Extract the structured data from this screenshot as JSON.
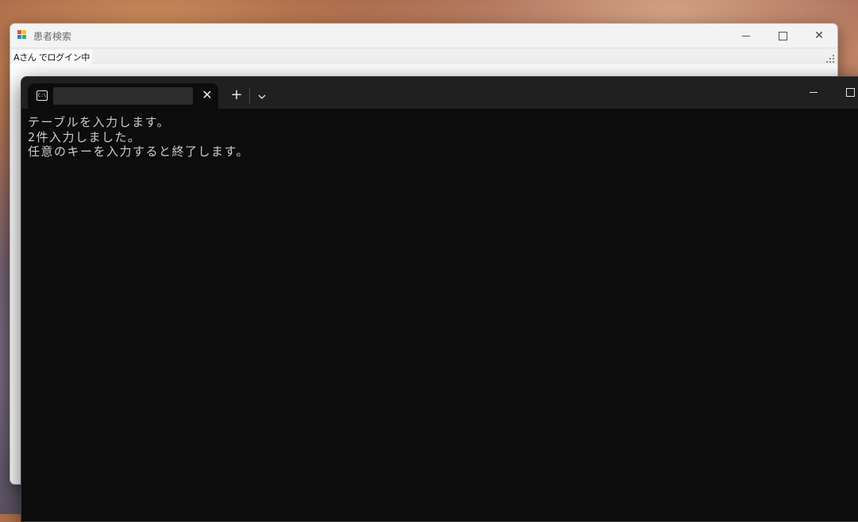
{
  "app_window": {
    "title": "患者検索",
    "status_label": "Aさん でログイン中",
    "controls": {
      "minimize": "—",
      "close": "✕"
    }
  },
  "terminal": {
    "tab_title": "",
    "tab_icon_text": "C:\\",
    "tab_close": "✕",
    "new_tab": "+",
    "dropdown": "⌄",
    "lines": [
      "テーブルを入力します。",
      "2件入力しました。",
      "任意のキーを入力すると終了します。"
    ]
  }
}
